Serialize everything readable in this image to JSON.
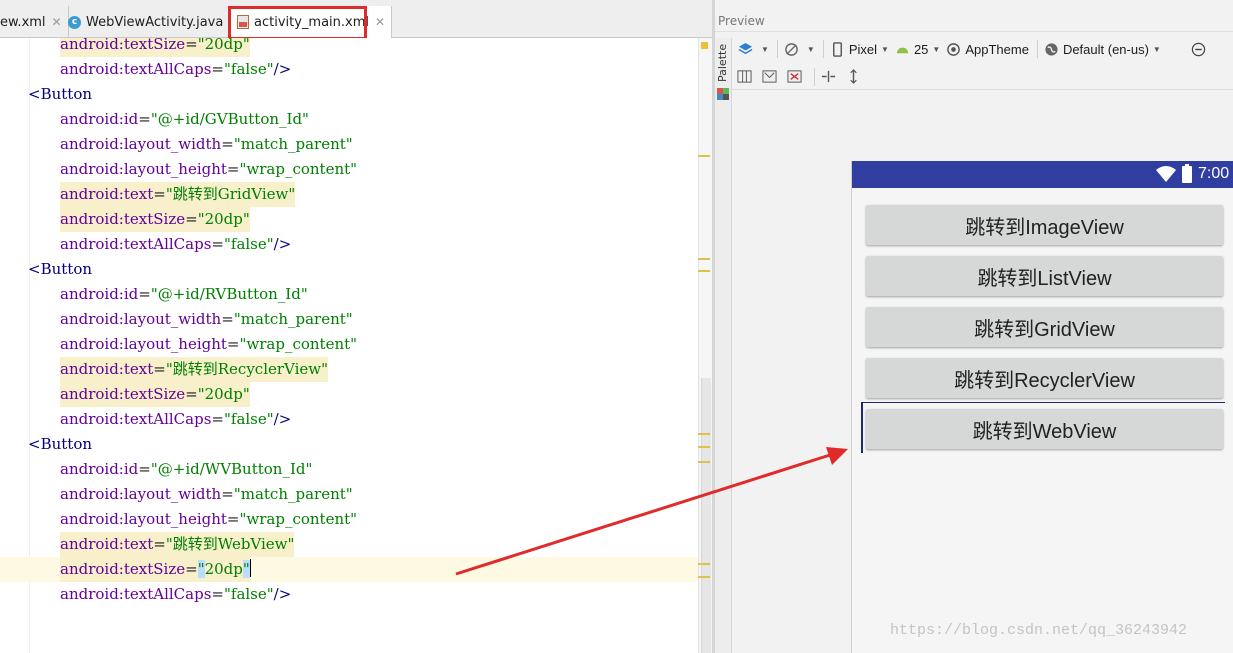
{
  "tabs": [
    {
      "label": "ew.xml"
    },
    {
      "label": "WebViewActivity.java",
      "icon": "class-icon"
    },
    {
      "label": "activity_main.xml",
      "icon": "xml-layout-icon",
      "active": true
    }
  ],
  "editor": {
    "lines": [
      {
        "indent": 2,
        "attr": "android:textSize",
        "val": "20dp",
        "close": false
      },
      {
        "indent": 2,
        "attr": "android:textAllCaps",
        "val": "false",
        "close": true
      },
      {
        "indent": 1,
        "tag": "Button"
      },
      {
        "indent": 2,
        "attr": "android:id",
        "val": "@+id/GVButton_Id"
      },
      {
        "indent": 2,
        "attr": "android:layout_width",
        "val": "match_parent"
      },
      {
        "indent": 2,
        "attr": "android:layout_height",
        "val": "wrap_content"
      },
      {
        "indent": 2,
        "attr": "android:text",
        "val": "跳转到GridView"
      },
      {
        "indent": 2,
        "attr": "android:textSize",
        "val": "20dp"
      },
      {
        "indent": 2,
        "attr": "android:textAllCaps",
        "val": "false",
        "close": true
      },
      {
        "indent": 1,
        "tag": "Button"
      },
      {
        "indent": 2,
        "attr": "android:id",
        "val": "@+id/RVButton_Id"
      },
      {
        "indent": 2,
        "attr": "android:layout_width",
        "val": "match_parent"
      },
      {
        "indent": 2,
        "attr": "android:layout_height",
        "val": "wrap_content"
      },
      {
        "indent": 2,
        "attr": "android:text",
        "val": "跳转到RecyclerView"
      },
      {
        "indent": 2,
        "attr": "android:textSize",
        "val": "20dp"
      },
      {
        "indent": 2,
        "attr": "android:textAllCaps",
        "val": "false",
        "close": true
      },
      {
        "indent": 1,
        "tag": "Button"
      },
      {
        "indent": 2,
        "attr": "android:id",
        "val": "@+id/WVButton_Id"
      },
      {
        "indent": 2,
        "attr": "android:layout_width",
        "val": "match_parent"
      },
      {
        "indent": 2,
        "attr": "android:layout_height",
        "val": "wrap_content"
      },
      {
        "indent": 2,
        "attr": "android:text",
        "val": "跳转到WebView"
      },
      {
        "indent": 2,
        "attr": "android:textSize",
        "val": "20dp",
        "current": true
      },
      {
        "indent": 2,
        "attr": "android:textAllCaps",
        "val": "false",
        "close": true
      }
    ]
  },
  "preview": {
    "header": "Preview",
    "palette_label": "Palette",
    "toolbar": {
      "device": "Pixel",
      "api": "25",
      "theme": "AppTheme",
      "locale": "Default (en-us)"
    },
    "device": {
      "time": "7:00",
      "statusbar_color": "#303f9f",
      "buttons": [
        "跳转到ImageView",
        "跳转到ListView",
        "跳转到GridView",
        "跳转到RecyclerView",
        "跳转到WebView"
      ]
    }
  },
  "watermark": "https://blog.csdn.net/qq_36243942"
}
